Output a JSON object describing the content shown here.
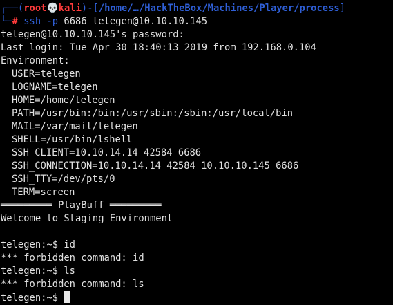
{
  "prompt": {
    "frame_top": "┌──(",
    "user": "root",
    "skull": "💀",
    "host": "kali",
    "frame_mid": ")-[",
    "path": "/home/…/HackTheBox/Machines/Player/process",
    "frame_end": "]",
    "frame_bottom": "└─",
    "hash": "#",
    "command": "ssh",
    "flag": "-p",
    "args": "6686 telegen@10.10.10.145"
  },
  "output": {
    "password_prompt": "telegen@10.10.10.145's password:",
    "last_login": "Last login: Tue Apr 30 18:40:13 2019 from 192.168.0.104",
    "environment_header": "Environment:",
    "env_vars": [
      "USER=telegen",
      "LOGNAME=telegen",
      "HOME=/home/telegen",
      "PATH=/usr/bin:/bin:/usr/sbin:/sbin:/usr/local/bin",
      "MAIL=/var/mail/telegen",
      "SHELL=/usr/bin/lshell",
      "SSH_CLIENT=10.10.14.14 42584 6686",
      "SSH_CONNECTION=10.10.14.14 42584 10.10.10.145 6686",
      "SSH_TTY=/dev/pts/0",
      "TERM=screen"
    ],
    "banner": "═════════ PlayBuff ═════════",
    "welcome": "Welcome to Staging Environment",
    "blank": "",
    "cmd1": "telegen:~$ id",
    "resp1": "*** forbidden command: id",
    "cmd2": "telegen:~$ ls",
    "resp2": "*** forbidden command: ls",
    "final_prompt": "telegen:~$ "
  }
}
